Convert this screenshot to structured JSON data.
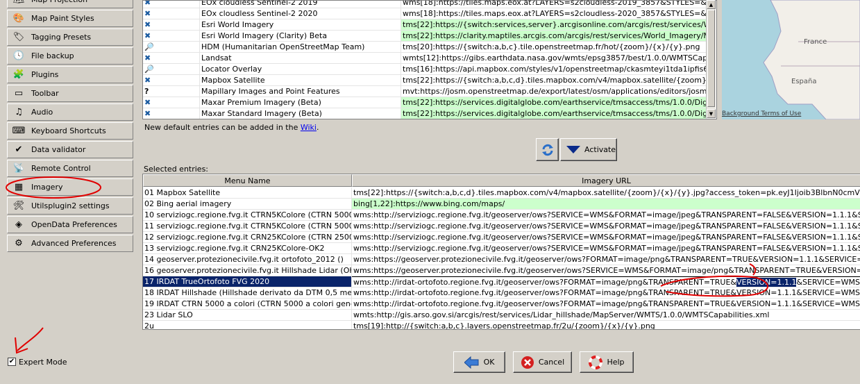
{
  "sidebar": {
    "items": [
      {
        "label": "Map Projection",
        "icon": "projection-icon"
      },
      {
        "label": "Map Paint Styles",
        "icon": "paint-styles-icon"
      },
      {
        "label": "Tagging Presets",
        "icon": "tag-icon"
      },
      {
        "label": "File backup",
        "icon": "clock-icon"
      },
      {
        "label": "Plugins",
        "icon": "puzzle-icon"
      },
      {
        "label": "Toolbar",
        "icon": "toolbar-icon"
      },
      {
        "label": "Audio",
        "icon": "music-note-icon"
      },
      {
        "label": "Keyboard Shortcuts",
        "icon": "keyboard-icon"
      },
      {
        "label": "Data validator",
        "icon": "checkmark-icon"
      },
      {
        "label": "Remote Control",
        "icon": "remote-icon"
      },
      {
        "label": "Imagery",
        "icon": "imagery-grid-icon"
      },
      {
        "label": "Utilsplugin2 settings",
        "icon": "tools-icon"
      },
      {
        "label": "OpenData Preferences",
        "icon": "opendata-icon"
      },
      {
        "label": "Advanced Preferences",
        "icon": "advanced-icon"
      }
    ],
    "expert_mode": "Expert Mode",
    "expert_checked": true
  },
  "defaults": {
    "rows": [
      {
        "name": "EOx cloudless Sentinel-2 2019",
        "url": "wms[18]:https://tiles.maps.eox.at?LAYERS=s2cloudless-2019_3857&STYLES=&FORMAT...",
        "green": false,
        "icon": "satellite-icon"
      },
      {
        "name": "EOx cloudless Sentinel-2 2020",
        "url": "wms[18]:https://tiles.maps.eox.at?LAYERS=s2cloudless-2020_3857&STYLES=&FORMAT...",
        "green": false,
        "icon": "satellite-icon"
      },
      {
        "name": "Esri World Imagery",
        "url": "tms[22]:https://{switch:services,server}.arcgisonline.com/arcgis/rest/services/World_Im...",
        "green": true,
        "icon": "satellite-icon"
      },
      {
        "name": "Esri World Imagery (Clarity) Beta",
        "url": "tms[22]:https://clarity.maptiles.arcgis.com/arcgis/rest/services/World_Imagery/MapServ...",
        "green": true,
        "icon": "satellite-icon"
      },
      {
        "name": "HDM (Humanitarian OpenStreetMap Team)",
        "url": "tms[20]:https://{switch:a,b,c}.tile.openstreetmap.fr/hot/{zoom}/{x}/{y}.png",
        "green": false,
        "icon": "map-icon"
      },
      {
        "name": "Landsat",
        "url": "wmts[12]:https://gibs.earthdata.nasa.gov/wmts/epsg3857/best/1.0.0/WMTSCapabilities...",
        "green": false,
        "icon": "satellite-icon"
      },
      {
        "name": "Locator Overlay",
        "url": "tms[16]:https://api.mapbox.com/styles/v1/openstreetmap/ckasmteyi1tda1ipfis6wqhuq/til...",
        "green": false,
        "icon": "map-icon"
      },
      {
        "name": "Mapbox Satellite",
        "url": "tms[22]:https://{switch:a,b,c,d}.tiles.mapbox.com/v4/mapbox.satellite/{zoom}/{x}/{y}.j...",
        "green": false,
        "icon": "satellite-icon"
      },
      {
        "name": "Mapillary Images and Point Features",
        "url": "mvt:https://josm.openstreetmap.de/export/latest/osm/applications/editors/josm/mvt/ma...",
        "green": false,
        "icon": "question-icon"
      },
      {
        "name": "Maxar Premium Imagery (Beta)",
        "url": "tms[22]:https://services.digitalglobe.com/earthservice/tmsaccess/tms/1.0.0/DigitalGlobe:...",
        "green": true,
        "icon": "satellite-icon"
      },
      {
        "name": "Maxar Standard Imagery (Beta)",
        "url": "tms[22]:https://services.digitalglobe.com/earthservice/tmsaccess/tms/1.0.0/DigitalGlobe:...",
        "green": true,
        "icon": "satellite-icon"
      }
    ],
    "wiki_note_prefix": "New default entries can be added in the ",
    "wiki_link": "Wiki",
    "wiki_note_suffix": "."
  },
  "map_preview": {
    "label_france": "France",
    "label_espana": "España",
    "attribution": "Background Terms of Use"
  },
  "actions": {
    "activate_label": "Activate",
    "refresh_icon": "refresh-icon"
  },
  "selected": {
    "title": "Selected entries:",
    "col_name": "Menu Name",
    "col_url": "Imagery URL",
    "rows": [
      {
        "name": "01 Mapbox Satellite",
        "url": "tms[22]:https://{switch:a,b,c,d}.tiles.mapbox.com/v4/mapbox.satellite/{zoom}/{x}/{y}.jpg?access_token=pk.eyJ1Ijoib3BlbnN0cmVldG1hcCIsImEiOiJja",
        "green": false,
        "selected": false
      },
      {
        "name": "02 Bing aerial imagery",
        "url": "bing[1,22]:https://www.bing.com/maps/",
        "green": true,
        "selected": false
      },
      {
        "name": "10 serviziogc.regione.fvg.it CTRN5KColore (CTRN 5000 Co...",
        "url": "wms:http://serviziogc.regione.fvg.it/geoserver/ows?SERVICE=WMS&FORMAT=image/jpeg&TRANSPARENT=FALSE&VERSION=1.1.1&SERVICE=WMS&R",
        "green": false,
        "selected": false
      },
      {
        "name": "11 serviziogc.regione.fvg.it CTRN5KColore (CTRN 5000 Co...",
        "url": "wms:http://serviziogc.regione.fvg.it/geoserver/ows?SERVICE=WMS&FORMAT=image/jpeg&TRANSPARENT=FALSE&VERSION=1.1.1&SERVICE=WMS&R",
        "green": false,
        "selected": false
      },
      {
        "name": "12 serviziogc.regione.fvg.it CRN25KColore (CTRN 25000)-OK",
        "url": "wms:http://serviziogc.regione.fvg.it/geoserver/ows?SERVICE=WMS&FORMAT=image/jpeg&TRANSPARENT=FALSE&VERSION=1.1.1&SERVICE=WMS&R",
        "green": false,
        "selected": false
      },
      {
        "name": "13 serviziogc.regione.fvg.it CRN25KColore-OK2",
        "url": "wms:http://serviziogc.regione.fvg.it/geoserver/ows?SERVICE=WMS&FORMAT=image/jpeg&TRANSPARENT=FALSE&VERSION=1.1.1&SERVICE=WMS&R",
        "green": false,
        "selected": false
      },
      {
        "name": "14 geoserver.protezionecivile.fvg.it ortofoto_2012 ()",
        "url": "wms:https://geoserver.protezionecivile.fvg.it/geoserver/ows?FORMAT=image/png&TRANSPARENT=TRUE&VERSION=1.1.1&SERVICE=WMS&REQUEST",
        "green": false,
        "selected": false
      },
      {
        "name": "16 geoserver.protezionecivile.fvg.it Hillshade Lidar (OK)",
        "url": "wms:https://geoserver.protezionecivile.fvg.it/geoserver/ows?SERVICE=WMS&FORMAT=image/png&TRANSPARENT=TRUE&VERSION=1.1.1&SERVICE=",
        "green": false,
        "selected": false
      },
      {
        "name": "17 IRDAT TrueOrtofoto FVG 2020",
        "url_pre": "wms:http://irdat-ortofoto.regione.fvg.it/geoserver/ows?FORMAT=image/png&TRANSPARENT=TRUE&",
        "url_hl": "VERSION=1.1.1",
        "url_post": "&SERVICE=WMS&REQUEST=GetM",
        "green": false,
        "selected": true
      },
      {
        "name": "18 IRDAT Hillshade (Hillshade derivato da DTM 0,5 metri rili...",
        "url": "wms:http://irdat-ortofoto.regione.fvg.it/geoserver/ows?FORMAT=image/png&TRANSPARENT=TRUE&VERSION=1.1.1&SERVICE=WMS&REQUEST=GetM",
        "green": false,
        "selected": false
      },
      {
        "name": "19 IRDAT CTRN 5000 a colori (CTRN 5000 a colori generat...",
        "url": "wms:http://irdat-ortofoto.regione.fvg.it/geoserver/ows?FORMAT=image/png&TRANSPARENT=TRUE&VERSION=1.1.1&SERVICE=WMS&REQUEST=GetM",
        "green": false,
        "selected": false
      },
      {
        "name": "23 Lidar SLO",
        "url": "wmts:http://gis.arso.gov.si/arcgis/rest/services/Lidar_hillshade/MapServer/WMTS/1.0.0/WMTSCapabilities.xml",
        "green": false,
        "selected": false
      },
      {
        "name": "2u",
        "url": "tms[19]:http://{switch:a,b,c}.layers.openstreetmap.fr/2u/{zoom}/{x}/{y}.png",
        "green": false,
        "selected": false
      }
    ]
  },
  "footer": {
    "ok": "OK",
    "cancel": "Cancel",
    "help": "Help"
  },
  "colors": {
    "selection": "#0a246a",
    "green_row": "#ccffcc",
    "annotation_red": "#e00000"
  }
}
